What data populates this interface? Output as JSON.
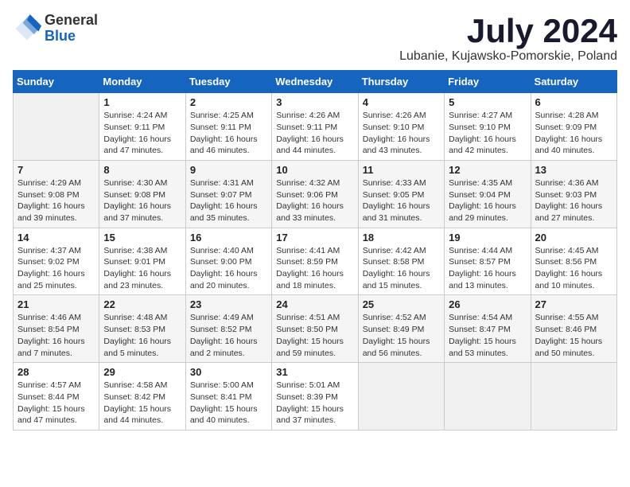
{
  "logo": {
    "general": "General",
    "blue": "Blue"
  },
  "title": {
    "month": "July 2024",
    "location": "Lubanie, Kujawsko-Pomorskie, Poland"
  },
  "calendar": {
    "headers": [
      "Sunday",
      "Monday",
      "Tuesday",
      "Wednesday",
      "Thursday",
      "Friday",
      "Saturday"
    ],
    "weeks": [
      [
        {
          "day": "",
          "info": ""
        },
        {
          "day": "1",
          "info": "Sunrise: 4:24 AM\nSunset: 9:11 PM\nDaylight: 16 hours and 47 minutes."
        },
        {
          "day": "2",
          "info": "Sunrise: 4:25 AM\nSunset: 9:11 PM\nDaylight: 16 hours and 46 minutes."
        },
        {
          "day": "3",
          "info": "Sunrise: 4:26 AM\nSunset: 9:11 PM\nDaylight: 16 hours and 44 minutes."
        },
        {
          "day": "4",
          "info": "Sunrise: 4:26 AM\nSunset: 9:10 PM\nDaylight: 16 hours and 43 minutes."
        },
        {
          "day": "5",
          "info": "Sunrise: 4:27 AM\nSunset: 9:10 PM\nDaylight: 16 hours and 42 minutes."
        },
        {
          "day": "6",
          "info": "Sunrise: 4:28 AM\nSunset: 9:09 PM\nDaylight: 16 hours and 40 minutes."
        }
      ],
      [
        {
          "day": "7",
          "info": "Sunrise: 4:29 AM\nSunset: 9:08 PM\nDaylight: 16 hours and 39 minutes."
        },
        {
          "day": "8",
          "info": "Sunrise: 4:30 AM\nSunset: 9:08 PM\nDaylight: 16 hours and 37 minutes."
        },
        {
          "day": "9",
          "info": "Sunrise: 4:31 AM\nSunset: 9:07 PM\nDaylight: 16 hours and 35 minutes."
        },
        {
          "day": "10",
          "info": "Sunrise: 4:32 AM\nSunset: 9:06 PM\nDaylight: 16 hours and 33 minutes."
        },
        {
          "day": "11",
          "info": "Sunrise: 4:33 AM\nSunset: 9:05 PM\nDaylight: 16 hours and 31 minutes."
        },
        {
          "day": "12",
          "info": "Sunrise: 4:35 AM\nSunset: 9:04 PM\nDaylight: 16 hours and 29 minutes."
        },
        {
          "day": "13",
          "info": "Sunrise: 4:36 AM\nSunset: 9:03 PM\nDaylight: 16 hours and 27 minutes."
        }
      ],
      [
        {
          "day": "14",
          "info": "Sunrise: 4:37 AM\nSunset: 9:02 PM\nDaylight: 16 hours and 25 minutes."
        },
        {
          "day": "15",
          "info": "Sunrise: 4:38 AM\nSunset: 9:01 PM\nDaylight: 16 hours and 23 minutes."
        },
        {
          "day": "16",
          "info": "Sunrise: 4:40 AM\nSunset: 9:00 PM\nDaylight: 16 hours and 20 minutes."
        },
        {
          "day": "17",
          "info": "Sunrise: 4:41 AM\nSunset: 8:59 PM\nDaylight: 16 hours and 18 minutes."
        },
        {
          "day": "18",
          "info": "Sunrise: 4:42 AM\nSunset: 8:58 PM\nDaylight: 16 hours and 15 minutes."
        },
        {
          "day": "19",
          "info": "Sunrise: 4:44 AM\nSunset: 8:57 PM\nDaylight: 16 hours and 13 minutes."
        },
        {
          "day": "20",
          "info": "Sunrise: 4:45 AM\nSunset: 8:56 PM\nDaylight: 16 hours and 10 minutes."
        }
      ],
      [
        {
          "day": "21",
          "info": "Sunrise: 4:46 AM\nSunset: 8:54 PM\nDaylight: 16 hours and 7 minutes."
        },
        {
          "day": "22",
          "info": "Sunrise: 4:48 AM\nSunset: 8:53 PM\nDaylight: 16 hours and 5 minutes."
        },
        {
          "day": "23",
          "info": "Sunrise: 4:49 AM\nSunset: 8:52 PM\nDaylight: 16 hours and 2 minutes."
        },
        {
          "day": "24",
          "info": "Sunrise: 4:51 AM\nSunset: 8:50 PM\nDaylight: 15 hours and 59 minutes."
        },
        {
          "day": "25",
          "info": "Sunrise: 4:52 AM\nSunset: 8:49 PM\nDaylight: 15 hours and 56 minutes."
        },
        {
          "day": "26",
          "info": "Sunrise: 4:54 AM\nSunset: 8:47 PM\nDaylight: 15 hours and 53 minutes."
        },
        {
          "day": "27",
          "info": "Sunrise: 4:55 AM\nSunset: 8:46 PM\nDaylight: 15 hours and 50 minutes."
        }
      ],
      [
        {
          "day": "28",
          "info": "Sunrise: 4:57 AM\nSunset: 8:44 PM\nDaylight: 15 hours and 47 minutes."
        },
        {
          "day": "29",
          "info": "Sunrise: 4:58 AM\nSunset: 8:42 PM\nDaylight: 15 hours and 44 minutes."
        },
        {
          "day": "30",
          "info": "Sunrise: 5:00 AM\nSunset: 8:41 PM\nDaylight: 15 hours and 40 minutes."
        },
        {
          "day": "31",
          "info": "Sunrise: 5:01 AM\nSunset: 8:39 PM\nDaylight: 15 hours and 37 minutes."
        },
        {
          "day": "",
          "info": ""
        },
        {
          "day": "",
          "info": ""
        },
        {
          "day": "",
          "info": ""
        }
      ]
    ]
  }
}
